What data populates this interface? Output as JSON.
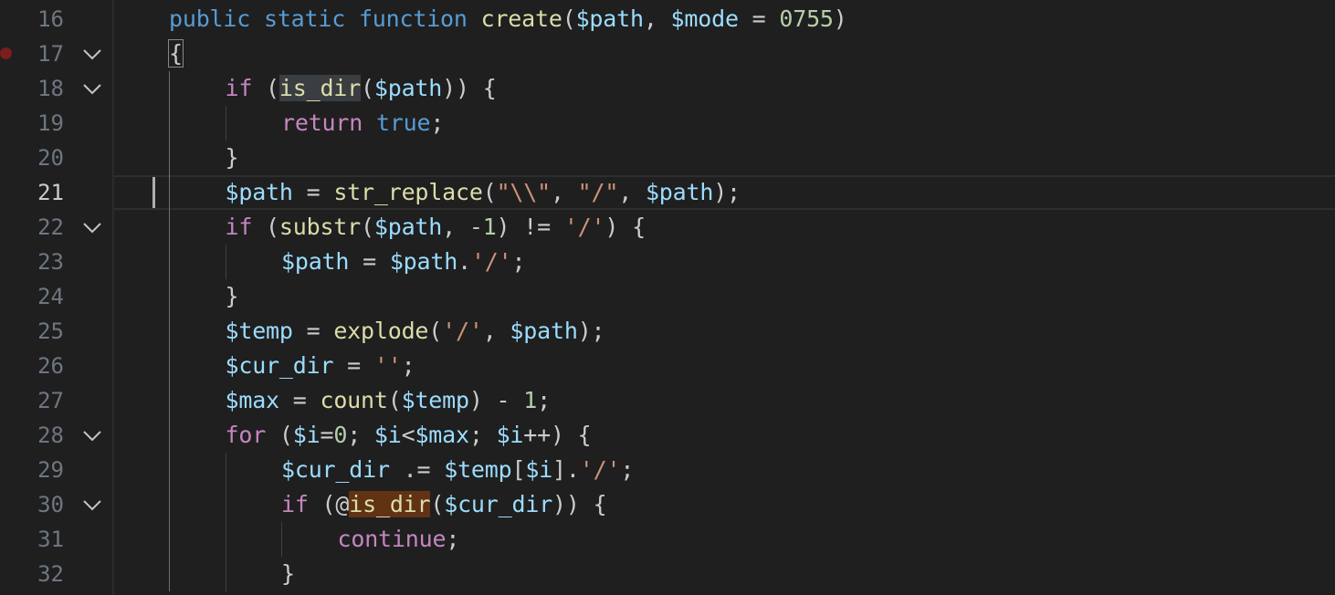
{
  "editor": {
    "language": "php",
    "cursor_line": 21,
    "breakpoint_line": 17,
    "folding_lines": [
      17,
      18,
      22,
      28,
      30
    ]
  },
  "lines": [
    {
      "n": "16",
      "indent": 0,
      "tokens": [
        {
          "t": "public",
          "c": "kw"
        },
        {
          "t": " ",
          "c": "pl"
        },
        {
          "t": "static",
          "c": "kw"
        },
        {
          "t": " ",
          "c": "pl"
        },
        {
          "t": "function",
          "c": "kw"
        },
        {
          "t": " ",
          "c": "pl"
        },
        {
          "t": "create",
          "c": "fn"
        },
        {
          "t": "(",
          "c": "pl"
        },
        {
          "t": "$path",
          "c": "var"
        },
        {
          "t": ", ",
          "c": "pl"
        },
        {
          "t": "$mode",
          "c": "var"
        },
        {
          "t": " = ",
          "c": "pl"
        },
        {
          "t": "0755",
          "c": "num"
        },
        {
          "t": ")",
          "c": "pl"
        }
      ]
    },
    {
      "n": "17",
      "indent": 0,
      "tokens": [
        {
          "t": "{",
          "c": "pl",
          "hl": "brace"
        }
      ]
    },
    {
      "n": "18",
      "indent": 1,
      "tokens": [
        {
          "t": "if",
          "c": "ctl"
        },
        {
          "t": " (",
          "c": "pl"
        },
        {
          "t": "is_dir",
          "c": "fn",
          "hl": "sel"
        },
        {
          "t": "(",
          "c": "pl"
        },
        {
          "t": "$path",
          "c": "var"
        },
        {
          "t": ")) {",
          "c": "pl"
        }
      ]
    },
    {
      "n": "19",
      "indent": 2,
      "tokens": [
        {
          "t": "return",
          "c": "ctl"
        },
        {
          "t": " ",
          "c": "pl"
        },
        {
          "t": "true",
          "c": "kw"
        },
        {
          "t": ";",
          "c": "pl"
        }
      ]
    },
    {
      "n": "20",
      "indent": 1,
      "tokens": [
        {
          "t": "}",
          "c": "pl"
        }
      ]
    },
    {
      "n": "21",
      "indent": 1,
      "tokens": [
        {
          "t": "$path",
          "c": "var"
        },
        {
          "t": " = ",
          "c": "pl"
        },
        {
          "t": "str_replace",
          "c": "fn"
        },
        {
          "t": "(",
          "c": "pl"
        },
        {
          "t": "\"\\\\\"",
          "c": "str"
        },
        {
          "t": ", ",
          "c": "pl"
        },
        {
          "t": "\"/\"",
          "c": "str"
        },
        {
          "t": ", ",
          "c": "pl"
        },
        {
          "t": "$path",
          "c": "var"
        },
        {
          "t": ");",
          "c": "pl"
        }
      ]
    },
    {
      "n": "22",
      "indent": 1,
      "tokens": [
        {
          "t": "if",
          "c": "ctl"
        },
        {
          "t": " (",
          "c": "pl"
        },
        {
          "t": "substr",
          "c": "fn"
        },
        {
          "t": "(",
          "c": "pl"
        },
        {
          "t": "$path",
          "c": "var"
        },
        {
          "t": ", ",
          "c": "pl"
        },
        {
          "t": "-1",
          "c": "num"
        },
        {
          "t": ") != ",
          "c": "pl"
        },
        {
          "t": "'/'",
          "c": "str"
        },
        {
          "t": ") {",
          "c": "pl"
        }
      ]
    },
    {
      "n": "23",
      "indent": 2,
      "tokens": [
        {
          "t": "$path",
          "c": "var"
        },
        {
          "t": " = ",
          "c": "pl"
        },
        {
          "t": "$path",
          "c": "var"
        },
        {
          "t": ".",
          "c": "pl"
        },
        {
          "t": "'/'",
          "c": "str"
        },
        {
          "t": ";",
          "c": "pl"
        }
      ]
    },
    {
      "n": "24",
      "indent": 1,
      "tokens": [
        {
          "t": "}",
          "c": "pl"
        }
      ]
    },
    {
      "n": "25",
      "indent": 1,
      "tokens": [
        {
          "t": "$temp",
          "c": "var"
        },
        {
          "t": " = ",
          "c": "pl"
        },
        {
          "t": "explode",
          "c": "fn"
        },
        {
          "t": "(",
          "c": "pl"
        },
        {
          "t": "'/'",
          "c": "str"
        },
        {
          "t": ", ",
          "c": "pl"
        },
        {
          "t": "$path",
          "c": "var"
        },
        {
          "t": ");",
          "c": "pl"
        }
      ]
    },
    {
      "n": "26",
      "indent": 1,
      "tokens": [
        {
          "t": "$cur_dir",
          "c": "var"
        },
        {
          "t": " = ",
          "c": "pl"
        },
        {
          "t": "''",
          "c": "str"
        },
        {
          "t": ";",
          "c": "pl"
        }
      ]
    },
    {
      "n": "27",
      "indent": 1,
      "tokens": [
        {
          "t": "$max",
          "c": "var"
        },
        {
          "t": " = ",
          "c": "pl"
        },
        {
          "t": "count",
          "c": "fn"
        },
        {
          "t": "(",
          "c": "pl"
        },
        {
          "t": "$temp",
          "c": "var"
        },
        {
          "t": ") - ",
          "c": "pl"
        },
        {
          "t": "1",
          "c": "num"
        },
        {
          "t": ";",
          "c": "pl"
        }
      ]
    },
    {
      "n": "28",
      "indent": 1,
      "tokens": [
        {
          "t": "for",
          "c": "ctl"
        },
        {
          "t": " (",
          "c": "pl"
        },
        {
          "t": "$i",
          "c": "var"
        },
        {
          "t": "=",
          "c": "pl"
        },
        {
          "t": "0",
          "c": "num"
        },
        {
          "t": "; ",
          "c": "pl"
        },
        {
          "t": "$i",
          "c": "var"
        },
        {
          "t": "<",
          "c": "pl"
        },
        {
          "t": "$max",
          "c": "var"
        },
        {
          "t": "; ",
          "c": "pl"
        },
        {
          "t": "$i",
          "c": "var"
        },
        {
          "t": "++) {",
          "c": "pl"
        }
      ]
    },
    {
      "n": "29",
      "indent": 2,
      "tokens": [
        {
          "t": "$cur_dir",
          "c": "var"
        },
        {
          "t": " .= ",
          "c": "pl"
        },
        {
          "t": "$temp",
          "c": "var"
        },
        {
          "t": "[",
          "c": "pl"
        },
        {
          "t": "$i",
          "c": "var"
        },
        {
          "t": "].",
          "c": "pl"
        },
        {
          "t": "'/'",
          "c": "str"
        },
        {
          "t": ";",
          "c": "pl"
        }
      ]
    },
    {
      "n": "30",
      "indent": 2,
      "tokens": [
        {
          "t": "if",
          "c": "ctl"
        },
        {
          "t": " (@",
          "c": "pl"
        },
        {
          "t": "is_dir",
          "c": "fn",
          "hl": "word"
        },
        {
          "t": "(",
          "c": "pl"
        },
        {
          "t": "$cur_dir",
          "c": "var"
        },
        {
          "t": ")) {",
          "c": "pl"
        }
      ]
    },
    {
      "n": "31",
      "indent": 3,
      "tokens": [
        {
          "t": "continue",
          "c": "ctl"
        },
        {
          "t": ";",
          "c": "pl"
        }
      ]
    },
    {
      "n": "32",
      "indent": 2,
      "tokens": [
        {
          "t": "}",
          "c": "pl"
        }
      ]
    }
  ]
}
